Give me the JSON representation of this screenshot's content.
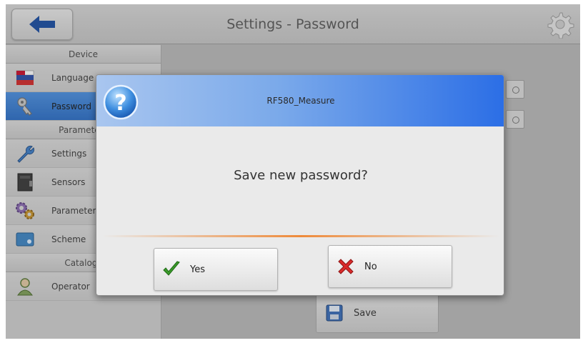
{
  "header": {
    "title": "Settings - Password"
  },
  "sidebar": {
    "sections": [
      {
        "title": "Device",
        "items": [
          {
            "label": "Language",
            "icon": "flag-icon"
          },
          {
            "label": "Password",
            "icon": "key-icon",
            "active": true
          }
        ]
      },
      {
        "title": "Parameters",
        "items": [
          {
            "label": "Settings",
            "icon": "wrench-icon"
          },
          {
            "label": "Sensors",
            "icon": "sensor-icon"
          },
          {
            "label": "Parameters",
            "icon": "gears-icon"
          },
          {
            "label": "Scheme",
            "icon": "scheme-icon"
          }
        ]
      },
      {
        "title": "Catalogs",
        "items": [
          {
            "label": "Operator",
            "icon": "operator-icon"
          }
        ]
      }
    ]
  },
  "main": {
    "save_label": "Save"
  },
  "dialog": {
    "title": "RF580_Measure",
    "message": "Save new password?",
    "yes_label": "Yes",
    "no_label": "No"
  },
  "colors": {
    "accent": "#2d6fc7",
    "dialog_title_start": "#a9c6ef",
    "dialog_title_end": "#2b6ee6",
    "separator": "#ee8a3a"
  }
}
